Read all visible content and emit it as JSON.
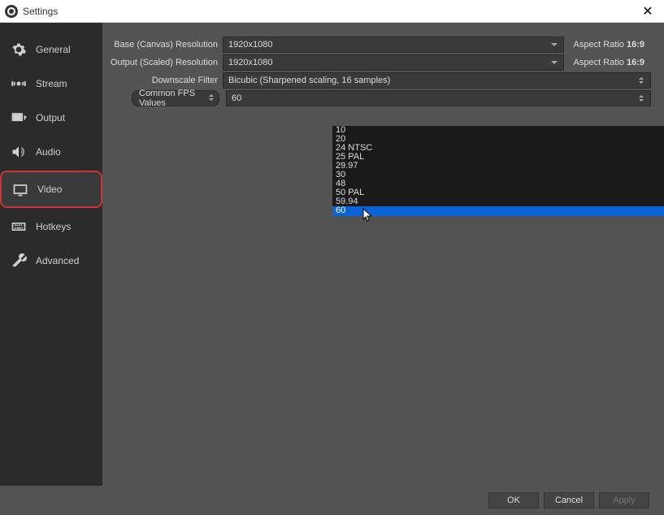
{
  "window": {
    "title": "Settings"
  },
  "sidebar": {
    "items": [
      {
        "label": "General"
      },
      {
        "label": "Stream"
      },
      {
        "label": "Output"
      },
      {
        "label": "Audio"
      },
      {
        "label": "Video"
      },
      {
        "label": "Hotkeys"
      },
      {
        "label": "Advanced"
      }
    ]
  },
  "form": {
    "base_res_label": "Base (Canvas) Resolution",
    "base_res_value": "1920x1080",
    "base_aspect": "Aspect Ratio",
    "base_aspect_ratio": "16:9",
    "output_res_label": "Output (Scaled) Resolution",
    "output_res_value": "1920x1080",
    "output_aspect": "Aspect Ratio",
    "output_aspect_ratio": "16:9",
    "downscale_label": "Downscale Filter",
    "downscale_value": "Bicubic (Sharpened scaling, 16 samples)",
    "fps_type_label": "Common FPS Values",
    "fps_value": "60"
  },
  "fps_options": [
    "10",
    "20",
    "24 NTSC",
    "25 PAL",
    "29.97",
    "30",
    "48",
    "50 PAL",
    "59.94",
    "60"
  ],
  "fps_selected": "60",
  "buttons": {
    "ok": "OK",
    "cancel": "Cancel",
    "apply": "Apply"
  }
}
